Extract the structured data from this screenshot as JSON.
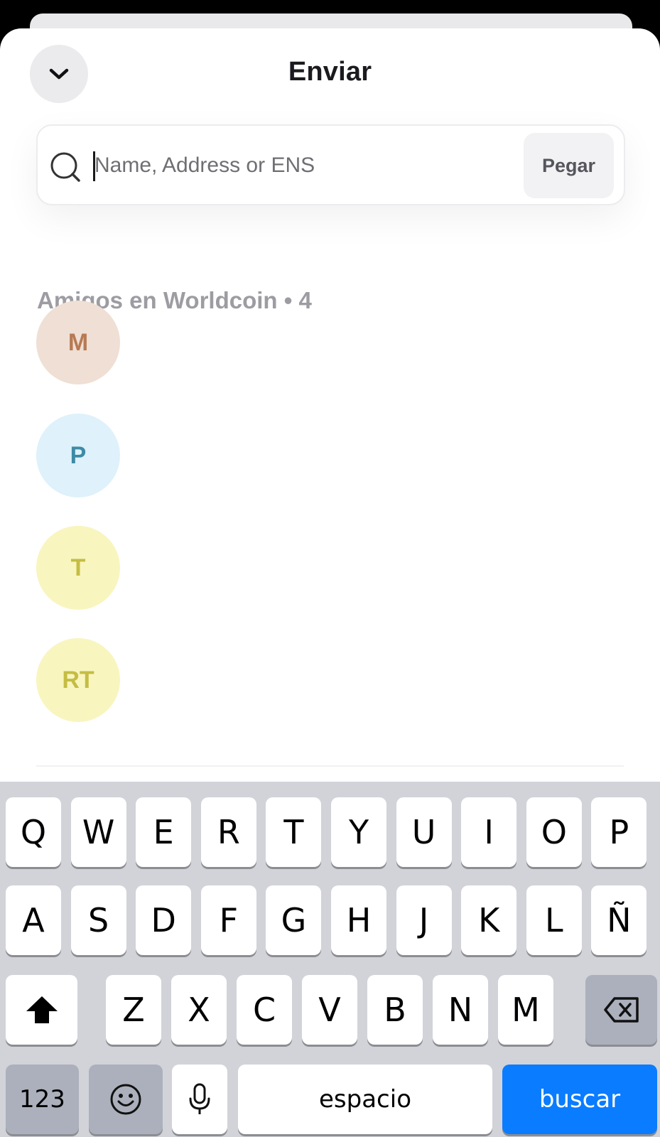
{
  "sheet": {
    "title": "Enviar",
    "collapse_icon": "chevron-down-icon"
  },
  "search": {
    "placeholder": "Name, Address or ENS",
    "value": "",
    "icon": "search-icon",
    "paste_label": "Pegar"
  },
  "friends": {
    "header": "Amigos en Worldcoin • 4",
    "contacts": [
      {
        "initials": "M",
        "bg": "#efdfd5",
        "fg": "#b77a52"
      },
      {
        "initials": "P",
        "bg": "#dff1fb",
        "fg": "#3d8ba6"
      },
      {
        "initials": "T",
        "bg": "#f8f5bf",
        "fg": "#c4bd43"
      },
      {
        "initials": "RT",
        "bg": "#f8f5bf",
        "fg": "#c4bd43"
      }
    ]
  },
  "keyboard": {
    "row1": [
      "Q",
      "W",
      "E",
      "R",
      "T",
      "Y",
      "U",
      "I",
      "O",
      "P"
    ],
    "row2": [
      "A",
      "S",
      "D",
      "F",
      "G",
      "H",
      "J",
      "K",
      "L",
      "Ñ"
    ],
    "row3": [
      "Z",
      "X",
      "C",
      "V",
      "B",
      "N",
      "M"
    ],
    "shift_icon": "shift-icon",
    "delete_icon": "backspace-icon",
    "numbers_label": "123",
    "emoji_icon": "emoji-icon",
    "mic_icon": "microphone-icon",
    "space_label": "espacio",
    "action_label": "buscar",
    "action_color": "#0a7cff"
  }
}
